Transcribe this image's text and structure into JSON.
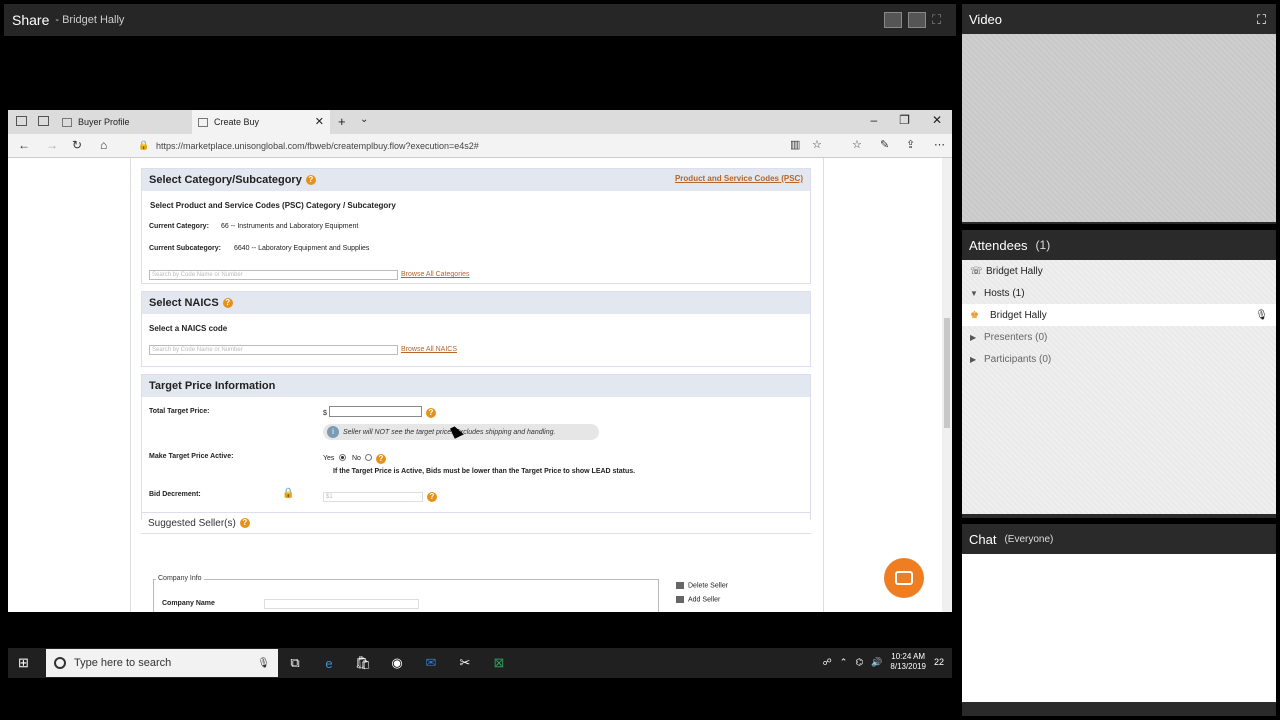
{
  "share": {
    "title": "Share",
    "presenter": "- Bridget Hally"
  },
  "browser": {
    "tabs": [
      {
        "label": "Buyer Profile"
      },
      {
        "label": "Create Buy"
      }
    ],
    "url": "https://marketplace.unisonglobal.com/fbweb/createmplbuy.flow?execution=e4s2#"
  },
  "category": {
    "heading": "Select Category/Subcategory",
    "psc_link": "Product and Service Codes (PSC)",
    "subheading": "Select Product and Service Codes (PSC) Category / Subcategory",
    "current_category_label": "Current Category:",
    "current_category_value": "66 -- Instruments and Laboratory Equipment",
    "current_subcategory_label": "Current Subcategory:",
    "current_subcategory_value": "6640 -- Laboratory Equipment and Supplies",
    "search_placeholder": "Search by Code Name or Number",
    "browse_link": "Browse All Categories"
  },
  "naics": {
    "heading": "Select NAICS",
    "subheading": "Select a NAICS code",
    "search_placeholder": "Search by Code Name or Number",
    "browse_link": "Browse All NAICS"
  },
  "target": {
    "heading": "Target Price Information",
    "total_label": "Total Target Price:",
    "currency": "$",
    "info": "Seller will NOT see the target price. Excludes shipping and handling.",
    "active_label": "Make Target Price Active:",
    "yes": "Yes",
    "no": "No",
    "active_note": "If the Target Price is Active, Bids must be lower than the Target Price to show LEAD status.",
    "decrement_label": "Bid Decrement:",
    "decrement_value": "$1"
  },
  "sellers": {
    "heading": "Suggested Seller(s)",
    "company_info": "Company Info",
    "company_name": "Company Name",
    "delete_seller": "Delete Seller",
    "add_seller": "Add Seller"
  },
  "taskbar": {
    "search_placeholder": "Type here to search",
    "time": "10:24 AM",
    "date": "8/13/2019",
    "notif_count": "22"
  },
  "video": {
    "title": "Video"
  },
  "attendees": {
    "title": "Attendees",
    "count": "(1)",
    "caller": "Bridget Hally",
    "hosts": "Hosts (1)",
    "host_name": "Bridget Hally",
    "presenters": "Presenters (0)",
    "participants": "Participants (0)"
  },
  "chat": {
    "title": "Chat",
    "scope": "(Everyone)"
  }
}
